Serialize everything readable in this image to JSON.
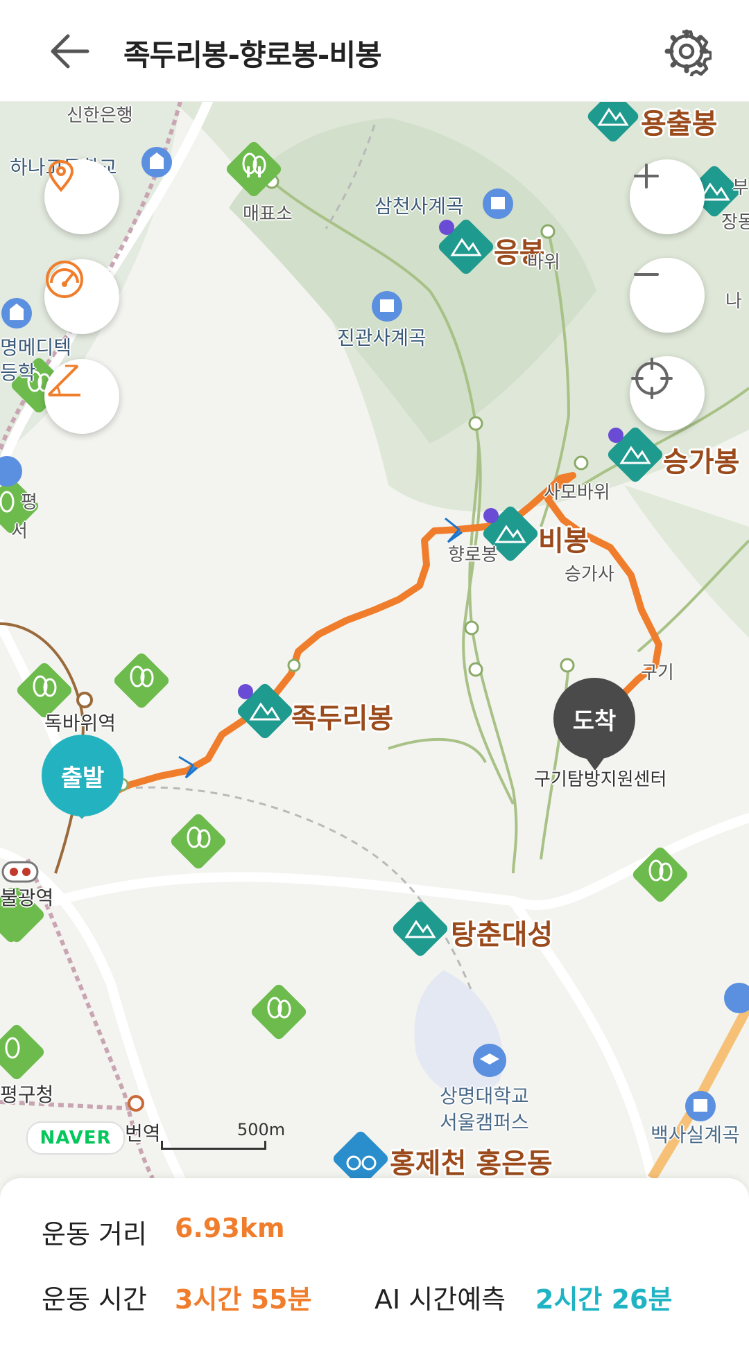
{
  "header": {
    "title": "족두리봉-향로봉-비봉"
  },
  "map": {
    "peaks": {
      "yongchulbong": "용출봉",
      "eungbong": "응봉",
      "seunggabong": "승가봉",
      "bibong": "비봉",
      "jokduribong": "족두리봉",
      "tangchundaeseong": "탕춘대성"
    },
    "pois": {
      "samcheonsa": "삼천사계곡",
      "jingwansa": "진관사계곡",
      "maepyoso": "매표소",
      "hana_school": "하나고등학교",
      "top_cut": "신한은행",
      "sangmyung": "상명대학교",
      "sangmyung2": "서울캠퍼스",
      "baeksasil": "백사실계곡",
      "hongje": "홍제천 홍은동",
      "guam": "구기탐방지원센터",
      "hyangro": "향로봉",
      "seungga": "승가사",
      "samo": "사모바위",
      "bawi": "바위",
      "gugi": "구기",
      "dongbullgwang": "독바위역",
      "bulgwang": "불광역",
      "gucheong": "평구청",
      "beonyeok": "번역",
      "ledge_left1": "명메디텍",
      "ledge_left2": "등학",
      "ledge_left3": "평",
      "ledge_left4": "서",
      "edge_right1": "나",
      "edge_right2": "장동암문",
      "edge_right3": "부"
    },
    "pins": {
      "start": "출발",
      "end": "도착"
    },
    "logo": "NAVER",
    "scale": "500m",
    "colors": {
      "route": "#f07d2b",
      "peak_marker": "#1e9a8e",
      "start_pin": "#23b3c0",
      "end_pin": "#4a4a4a"
    }
  },
  "stats": {
    "distance_label": "운동 거리",
    "distance_value": "6.93km",
    "time_label": "운동 시간",
    "time_value": "3시간 55분",
    "ai_label": "AI 시간예측",
    "ai_value": "2시간 26분"
  },
  "icons": [
    "back-arrow-icon",
    "settings-gear-icon",
    "location-pin-icon",
    "speedometer-icon",
    "slope-icon",
    "zoom-in-icon",
    "zoom-out-icon",
    "gps-target-icon"
  ]
}
